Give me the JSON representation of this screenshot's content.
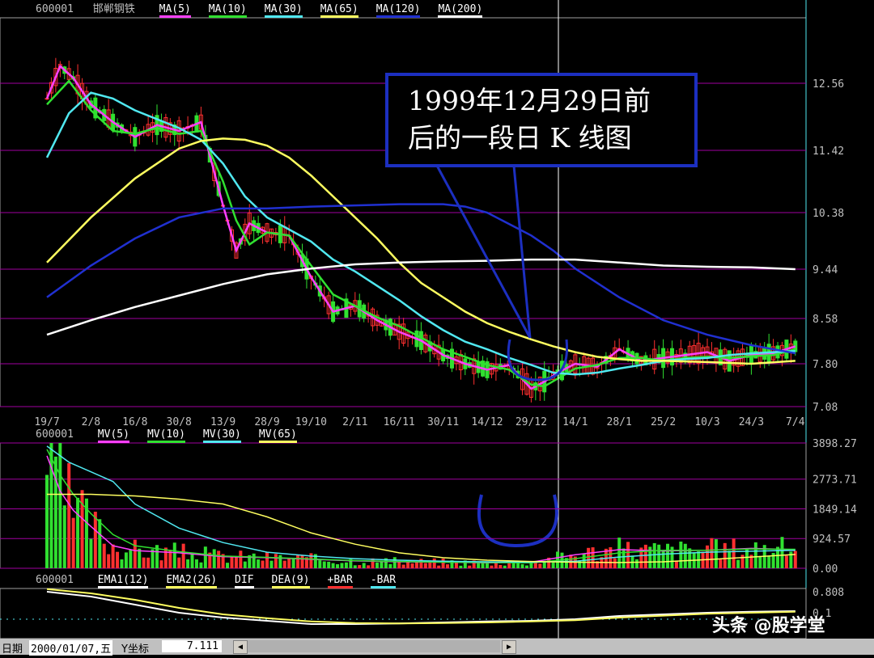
{
  "price_header": {
    "code": "600001",
    "name": "邯郸钢铁",
    "items": [
      {
        "label": "MA(5)",
        "color": "#ff40ff"
      },
      {
        "label": "MA(10)",
        "color": "#30e030"
      },
      {
        "label": "MA(30)",
        "color": "#50e8f0"
      },
      {
        "label": "MA(65)",
        "color": "#ffff60"
      },
      {
        "label": "MA(120)",
        "color": "#2030d0"
      },
      {
        "label": "MA(200)",
        "color": "#ffffff"
      }
    ]
  },
  "volume_header": {
    "code": "600001",
    "items": [
      {
        "label": "MV(5)",
        "color": "#ff40ff"
      },
      {
        "label": "MV(10)",
        "color": "#30e030"
      },
      {
        "label": "MV(30)",
        "color": "#50e8f0"
      },
      {
        "label": "MV(65)",
        "color": "#ffff60"
      }
    ]
  },
  "macd_header": {
    "code": "600001",
    "items": [
      {
        "label": "EMA1(12)",
        "color": "#ffffff"
      },
      {
        "label": "EMA2(26)",
        "color": "#ffff60"
      },
      {
        "label": "DIF",
        "color": "#ffffff"
      },
      {
        "label": "DEA(9)",
        "color": "#ffff60"
      },
      {
        "label": "+BAR",
        "color": "#ff3030"
      },
      {
        "label": "-BAR",
        "color": "#50e8f0"
      }
    ]
  },
  "callout": {
    "line1": "1999年12月29日前",
    "line2": "后的一段日 K 线图"
  },
  "status": {
    "label": "日期",
    "date": "2000/01/07,五",
    "coord_label": "Y坐标",
    "coord_value": "7.111"
  },
  "watermark": "头条 @股学堂",
  "chart_data": [
    {
      "type": "candlestick",
      "title": "",
      "x_tick_labels": [
        "19/7",
        "2/8",
        "16/8",
        "30/8",
        "13/9",
        "28/9",
        "19/10",
        "2/11",
        "16/11",
        "30/11",
        "14/12",
        "29/12",
        "14/1",
        "28/1",
        "25/2",
        "10/3",
        "24/3",
        "7/4"
      ],
      "y_tick_labels": [
        "12.56",
        "11.42",
        "10.38",
        "9.44",
        "8.58",
        "7.80",
        "7.08"
      ],
      "ylim": [
        7.08,
        13.3
      ],
      "series": [
        {
          "name": "MA(5)",
          "color": "#ff40ff",
          "x": [
            0,
            0.3,
            0.6,
            1,
            1.5,
            2,
            2.5,
            3,
            3.5,
            4,
            4.3,
            4.6,
            5,
            5.5,
            6,
            6.5,
            7,
            7.5,
            8,
            8.5,
            9,
            9.5,
            10,
            10.5,
            11,
            11.3,
            11.6,
            12,
            12.5,
            13,
            13.5,
            14,
            14.5,
            15,
            15.5,
            16,
            16.5,
            17
          ],
          "values": [
            12.3,
            12.85,
            12.65,
            12.2,
            11.9,
            11.65,
            11.85,
            11.75,
            11.9,
            10.5,
            9.75,
            10.2,
            10.05,
            10.0,
            9.3,
            8.7,
            8.8,
            8.55,
            8.35,
            8.2,
            7.95,
            7.8,
            7.7,
            7.78,
            7.38,
            7.5,
            7.65,
            7.8,
            7.75,
            8.05,
            7.85,
            7.9,
            7.95,
            8.0,
            7.85,
            7.95,
            7.98,
            8.1
          ]
        },
        {
          "name": "MA(10)",
          "color": "#30e030",
          "x": [
            0,
            0.5,
            1,
            1.5,
            2,
            2.5,
            3,
            3.5,
            4,
            4.3,
            4.6,
            5,
            5.5,
            6,
            6.5,
            7,
            7.5,
            8,
            8.5,
            9,
            9.5,
            10,
            10.5,
            11,
            11.3,
            11.6,
            12,
            12.5,
            13,
            13.5,
            14,
            14.5,
            15,
            15.5,
            16,
            16.5,
            17
          ],
          "values": [
            12.2,
            12.6,
            12.1,
            11.75,
            11.7,
            11.8,
            11.7,
            11.75,
            10.9,
            10.25,
            9.85,
            10.05,
            10.0,
            9.5,
            9.0,
            8.8,
            8.6,
            8.45,
            8.25,
            8.05,
            7.92,
            7.78,
            7.7,
            7.45,
            7.42,
            7.55,
            7.72,
            7.78,
            7.9,
            7.9,
            7.85,
            7.9,
            7.92,
            7.9,
            7.93,
            7.95,
            8.05
          ]
        },
        {
          "name": "MA(30)",
          "color": "#50e8f0",
          "x": [
            0,
            0.5,
            1,
            1.5,
            2,
            2.5,
            3,
            3.5,
            4,
            4.5,
            5,
            5.5,
            6,
            6.5,
            7,
            7.5,
            8,
            8.5,
            9,
            9.5,
            10,
            10.5,
            11,
            11.5,
            12,
            12.5,
            13,
            13.5,
            14,
            14.5,
            15,
            15.5,
            16,
            16.5,
            17
          ],
          "values": [
            11.3,
            12.05,
            12.4,
            12.3,
            12.1,
            11.95,
            11.8,
            11.6,
            11.2,
            10.65,
            10.3,
            10.1,
            9.9,
            9.6,
            9.4,
            9.15,
            8.9,
            8.62,
            8.38,
            8.18,
            8.05,
            7.9,
            7.78,
            7.65,
            7.62,
            7.65,
            7.72,
            7.78,
            7.85,
            7.88,
            7.9,
            7.95,
            7.98,
            8.0,
            8.02
          ]
        },
        {
          "name": "MA(65)",
          "color": "#ffff60",
          "x": [
            0,
            1,
            2,
            3,
            3.5,
            4,
            4.5,
            5,
            5.5,
            6,
            6.5,
            7,
            7.5,
            8,
            8.5,
            9,
            9.5,
            10,
            10.5,
            11,
            11.5,
            12,
            12.5,
            13,
            13.5,
            14,
            15,
            16,
            17
          ],
          "values": [
            9.55,
            10.3,
            10.95,
            11.45,
            11.58,
            11.62,
            11.6,
            11.5,
            11.3,
            11.0,
            10.65,
            10.3,
            9.95,
            9.55,
            9.2,
            8.95,
            8.7,
            8.5,
            8.35,
            8.22,
            8.1,
            8.0,
            7.92,
            7.88,
            7.85,
            7.85,
            7.83,
            7.8,
            7.85
          ]
        },
        {
          "name": "MA(120)",
          "color": "#2030d0",
          "x": [
            0,
            1,
            2,
            3,
            4,
            5,
            6,
            7,
            8,
            9,
            9.5,
            10,
            11,
            11.5,
            12,
            12.5,
            13,
            14,
            15,
            16,
            17
          ],
          "values": [
            8.95,
            9.5,
            9.95,
            10.3,
            10.45,
            10.45,
            10.48,
            10.5,
            10.52,
            10.52,
            10.48,
            10.38,
            10.0,
            9.75,
            9.45,
            9.2,
            8.95,
            8.55,
            8.3,
            8.12,
            7.98
          ]
        },
        {
          "name": "MA(200)",
          "color": "#ffffff",
          "x": [
            0,
            1,
            2,
            3,
            4,
            5,
            6,
            7,
            8,
            9,
            10,
            11,
            12,
            13,
            14,
            15,
            16,
            17
          ],
          "values": [
            8.3,
            8.55,
            8.78,
            8.98,
            9.18,
            9.35,
            9.45,
            9.52,
            9.55,
            9.57,
            9.58,
            9.6,
            9.6,
            9.55,
            9.5,
            9.48,
            9.47,
            9.44
          ]
        }
      ]
    },
    {
      "type": "bar",
      "title": "",
      "y_tick_labels": [
        "3898.27",
        "2773.71",
        "1849.14",
        "924.57",
        "0.00"
      ],
      "ylim": [
        0,
        3898.27
      ],
      "series": [
        {
          "name": "MV(5)",
          "color": "#ff40ff",
          "x": [
            0,
            0.3,
            0.6,
            1,
            1.5,
            2,
            3,
            4,
            5,
            6,
            7,
            8,
            9,
            10,
            11,
            12,
            13,
            14,
            15,
            16,
            17
          ],
          "values": [
            3500,
            2400,
            1800,
            1300,
            700,
            550,
            480,
            360,
            330,
            280,
            230,
            200,
            190,
            170,
            190,
            420,
            580,
            540,
            560,
            620,
            580
          ]
        },
        {
          "name": "MV(10)",
          "color": "#30e030",
          "x": [
            0,
            0.3,
            0.6,
            1,
            1.5,
            2,
            3,
            4,
            5,
            6,
            7,
            8,
            9,
            10,
            11,
            12,
            13,
            14,
            15,
            16,
            17
          ],
          "values": [
            3700,
            2900,
            2300,
            1700,
            1050,
            700,
            520,
            380,
            340,
            290,
            240,
            210,
            190,
            180,
            170,
            300,
            480,
            560,
            560,
            600,
            590
          ]
        },
        {
          "name": "MV(30)",
          "color": "#50e8f0",
          "x": [
            0,
            0.5,
            1,
            1.5,
            2,
            3,
            4,
            5,
            6,
            7,
            8,
            9,
            10,
            11,
            12,
            13,
            14,
            15,
            16,
            17
          ],
          "values": [
            3800,
            3300,
            3000,
            2700,
            2000,
            1250,
            800,
            500,
            380,
            300,
            250,
            220,
            200,
            190,
            220,
            350,
            440,
            500,
            530,
            560
          ]
        },
        {
          "name": "MV(65)",
          "color": "#ffff60",
          "x": [
            0,
            0.5,
            1,
            2,
            3,
            4,
            5,
            6,
            7,
            8,
            9,
            10,
            11,
            12,
            13,
            14,
            15,
            16,
            17
          ],
          "values": [
            2300,
            2300,
            2300,
            2250,
            2150,
            2000,
            1600,
            1100,
            750,
            480,
            330,
            250,
            210,
            190,
            180,
            200,
            270,
            350,
            430
          ]
        }
      ]
    },
    {
      "type": "line",
      "title": "",
      "y_tick_labels": [
        "0.808",
        "0.1"
      ],
      "series": [
        {
          "name": "DIF",
          "color": "#ffffff",
          "x": [
            0,
            1,
            2,
            3,
            4,
            5,
            6,
            7,
            8,
            9,
            10,
            11,
            12,
            13,
            14,
            15,
            16,
            17
          ],
          "values": [
            0.7,
            0.55,
            0.3,
            0.05,
            -0.1,
            -0.2,
            -0.3,
            -0.3,
            -0.28,
            -0.25,
            -0.22,
            -0.2,
            -0.15,
            -0.05,
            0.0,
            0.05,
            0.08,
            0.1
          ]
        },
        {
          "name": "DEA(9)",
          "color": "#ffff60",
          "x": [
            0,
            1,
            2,
            3,
            4,
            5,
            6,
            7,
            8,
            9,
            10,
            11,
            12,
            13,
            14,
            15,
            16,
            17
          ],
          "values": [
            0.78,
            0.65,
            0.45,
            0.2,
            0.0,
            -0.12,
            -0.22,
            -0.27,
            -0.28,
            -0.27,
            -0.25,
            -0.22,
            -0.18,
            -0.1,
            -0.04,
            0.02,
            0.05,
            0.08
          ]
        }
      ]
    }
  ]
}
